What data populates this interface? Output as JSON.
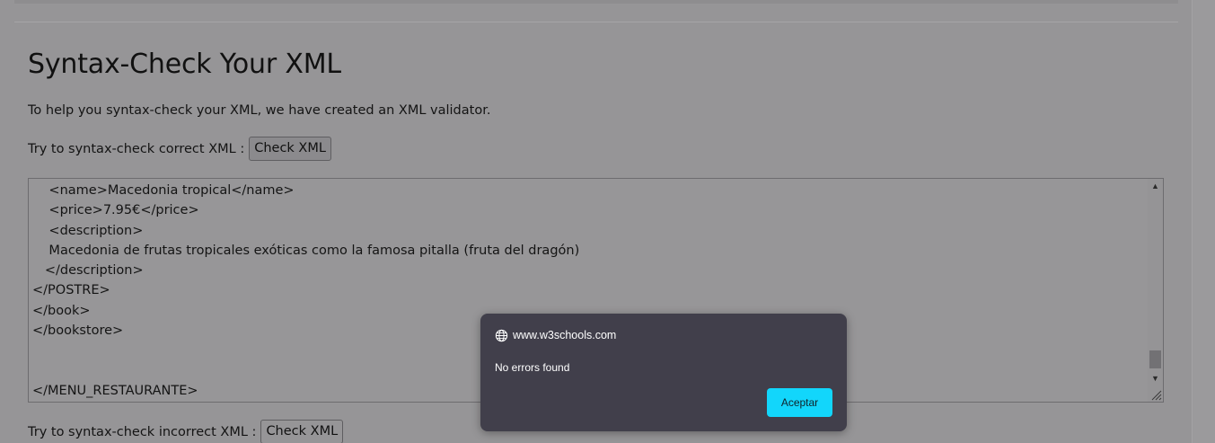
{
  "page": {
    "title": "Syntax-Check Your XML",
    "intro": "To help you syntax-check your XML, we have created an XML validator."
  },
  "correct_check": {
    "label": "Try to syntax-check correct XML :",
    "button_label": "Check XML"
  },
  "incorrect_check": {
    "label": "Try to syntax-check incorrect XML :",
    "button_label": "Check XML"
  },
  "xml_editor": {
    "content": "    <name>Macedonia tropical</name>\n    <price>7.95€</price>\n    <description>\n    Macedonia de frutas tropicales exóticas como la famosa pitalla (fruta del dragón)\n   </description>\n</POSTRE>\n</book>\n</bookstore>\n\n\n</MENU_RESTAURANTE>"
  },
  "alert_dialog": {
    "origin": "www.w3schools.com",
    "message": "No errors found",
    "ok_label": "Aceptar",
    "icon": "globe-icon"
  },
  "colors": {
    "overlay_bg": "#969597",
    "dialog_bg": "#413f4b",
    "accent": "#12d6fb"
  }
}
